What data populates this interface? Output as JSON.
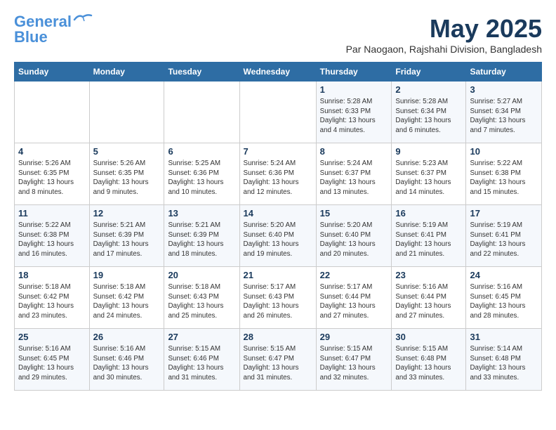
{
  "logo": {
    "line1": "General",
    "line2": "Blue"
  },
  "title": {
    "month_year": "May 2025",
    "location": "Par Naogaon, Rajshahi Division, Bangladesh"
  },
  "headers": [
    "Sunday",
    "Monday",
    "Tuesday",
    "Wednesday",
    "Thursday",
    "Friday",
    "Saturday"
  ],
  "weeks": [
    [
      {
        "day": "",
        "info": ""
      },
      {
        "day": "",
        "info": ""
      },
      {
        "day": "",
        "info": ""
      },
      {
        "day": "",
        "info": ""
      },
      {
        "day": "1",
        "info": "Sunrise: 5:28 AM\nSunset: 6:33 PM\nDaylight: 13 hours\nand 4 minutes."
      },
      {
        "day": "2",
        "info": "Sunrise: 5:28 AM\nSunset: 6:34 PM\nDaylight: 13 hours\nand 6 minutes."
      },
      {
        "day": "3",
        "info": "Sunrise: 5:27 AM\nSunset: 6:34 PM\nDaylight: 13 hours\nand 7 minutes."
      }
    ],
    [
      {
        "day": "4",
        "info": "Sunrise: 5:26 AM\nSunset: 6:35 PM\nDaylight: 13 hours\nand 8 minutes."
      },
      {
        "day": "5",
        "info": "Sunrise: 5:26 AM\nSunset: 6:35 PM\nDaylight: 13 hours\nand 9 minutes."
      },
      {
        "day": "6",
        "info": "Sunrise: 5:25 AM\nSunset: 6:36 PM\nDaylight: 13 hours\nand 10 minutes."
      },
      {
        "day": "7",
        "info": "Sunrise: 5:24 AM\nSunset: 6:36 PM\nDaylight: 13 hours\nand 12 minutes."
      },
      {
        "day": "8",
        "info": "Sunrise: 5:24 AM\nSunset: 6:37 PM\nDaylight: 13 hours\nand 13 minutes."
      },
      {
        "day": "9",
        "info": "Sunrise: 5:23 AM\nSunset: 6:37 PM\nDaylight: 13 hours\nand 14 minutes."
      },
      {
        "day": "10",
        "info": "Sunrise: 5:22 AM\nSunset: 6:38 PM\nDaylight: 13 hours\nand 15 minutes."
      }
    ],
    [
      {
        "day": "11",
        "info": "Sunrise: 5:22 AM\nSunset: 6:38 PM\nDaylight: 13 hours\nand 16 minutes."
      },
      {
        "day": "12",
        "info": "Sunrise: 5:21 AM\nSunset: 6:39 PM\nDaylight: 13 hours\nand 17 minutes."
      },
      {
        "day": "13",
        "info": "Sunrise: 5:21 AM\nSunset: 6:39 PM\nDaylight: 13 hours\nand 18 minutes."
      },
      {
        "day": "14",
        "info": "Sunrise: 5:20 AM\nSunset: 6:40 PM\nDaylight: 13 hours\nand 19 minutes."
      },
      {
        "day": "15",
        "info": "Sunrise: 5:20 AM\nSunset: 6:40 PM\nDaylight: 13 hours\nand 20 minutes."
      },
      {
        "day": "16",
        "info": "Sunrise: 5:19 AM\nSunset: 6:41 PM\nDaylight: 13 hours\nand 21 minutes."
      },
      {
        "day": "17",
        "info": "Sunrise: 5:19 AM\nSunset: 6:41 PM\nDaylight: 13 hours\nand 22 minutes."
      }
    ],
    [
      {
        "day": "18",
        "info": "Sunrise: 5:18 AM\nSunset: 6:42 PM\nDaylight: 13 hours\nand 23 minutes."
      },
      {
        "day": "19",
        "info": "Sunrise: 5:18 AM\nSunset: 6:42 PM\nDaylight: 13 hours\nand 24 minutes."
      },
      {
        "day": "20",
        "info": "Sunrise: 5:18 AM\nSunset: 6:43 PM\nDaylight: 13 hours\nand 25 minutes."
      },
      {
        "day": "21",
        "info": "Sunrise: 5:17 AM\nSunset: 6:43 PM\nDaylight: 13 hours\nand 26 minutes."
      },
      {
        "day": "22",
        "info": "Sunrise: 5:17 AM\nSunset: 6:44 PM\nDaylight: 13 hours\nand 27 minutes."
      },
      {
        "day": "23",
        "info": "Sunrise: 5:16 AM\nSunset: 6:44 PM\nDaylight: 13 hours\nand 27 minutes."
      },
      {
        "day": "24",
        "info": "Sunrise: 5:16 AM\nSunset: 6:45 PM\nDaylight: 13 hours\nand 28 minutes."
      }
    ],
    [
      {
        "day": "25",
        "info": "Sunrise: 5:16 AM\nSunset: 6:45 PM\nDaylight: 13 hours\nand 29 minutes."
      },
      {
        "day": "26",
        "info": "Sunrise: 5:16 AM\nSunset: 6:46 PM\nDaylight: 13 hours\nand 30 minutes."
      },
      {
        "day": "27",
        "info": "Sunrise: 5:15 AM\nSunset: 6:46 PM\nDaylight: 13 hours\nand 31 minutes."
      },
      {
        "day": "28",
        "info": "Sunrise: 5:15 AM\nSunset: 6:47 PM\nDaylight: 13 hours\nand 31 minutes."
      },
      {
        "day": "29",
        "info": "Sunrise: 5:15 AM\nSunset: 6:47 PM\nDaylight: 13 hours\nand 32 minutes."
      },
      {
        "day": "30",
        "info": "Sunrise: 5:15 AM\nSunset: 6:48 PM\nDaylight: 13 hours\nand 33 minutes."
      },
      {
        "day": "31",
        "info": "Sunrise: 5:14 AM\nSunset: 6:48 PM\nDaylight: 13 hours\nand 33 minutes."
      }
    ]
  ]
}
